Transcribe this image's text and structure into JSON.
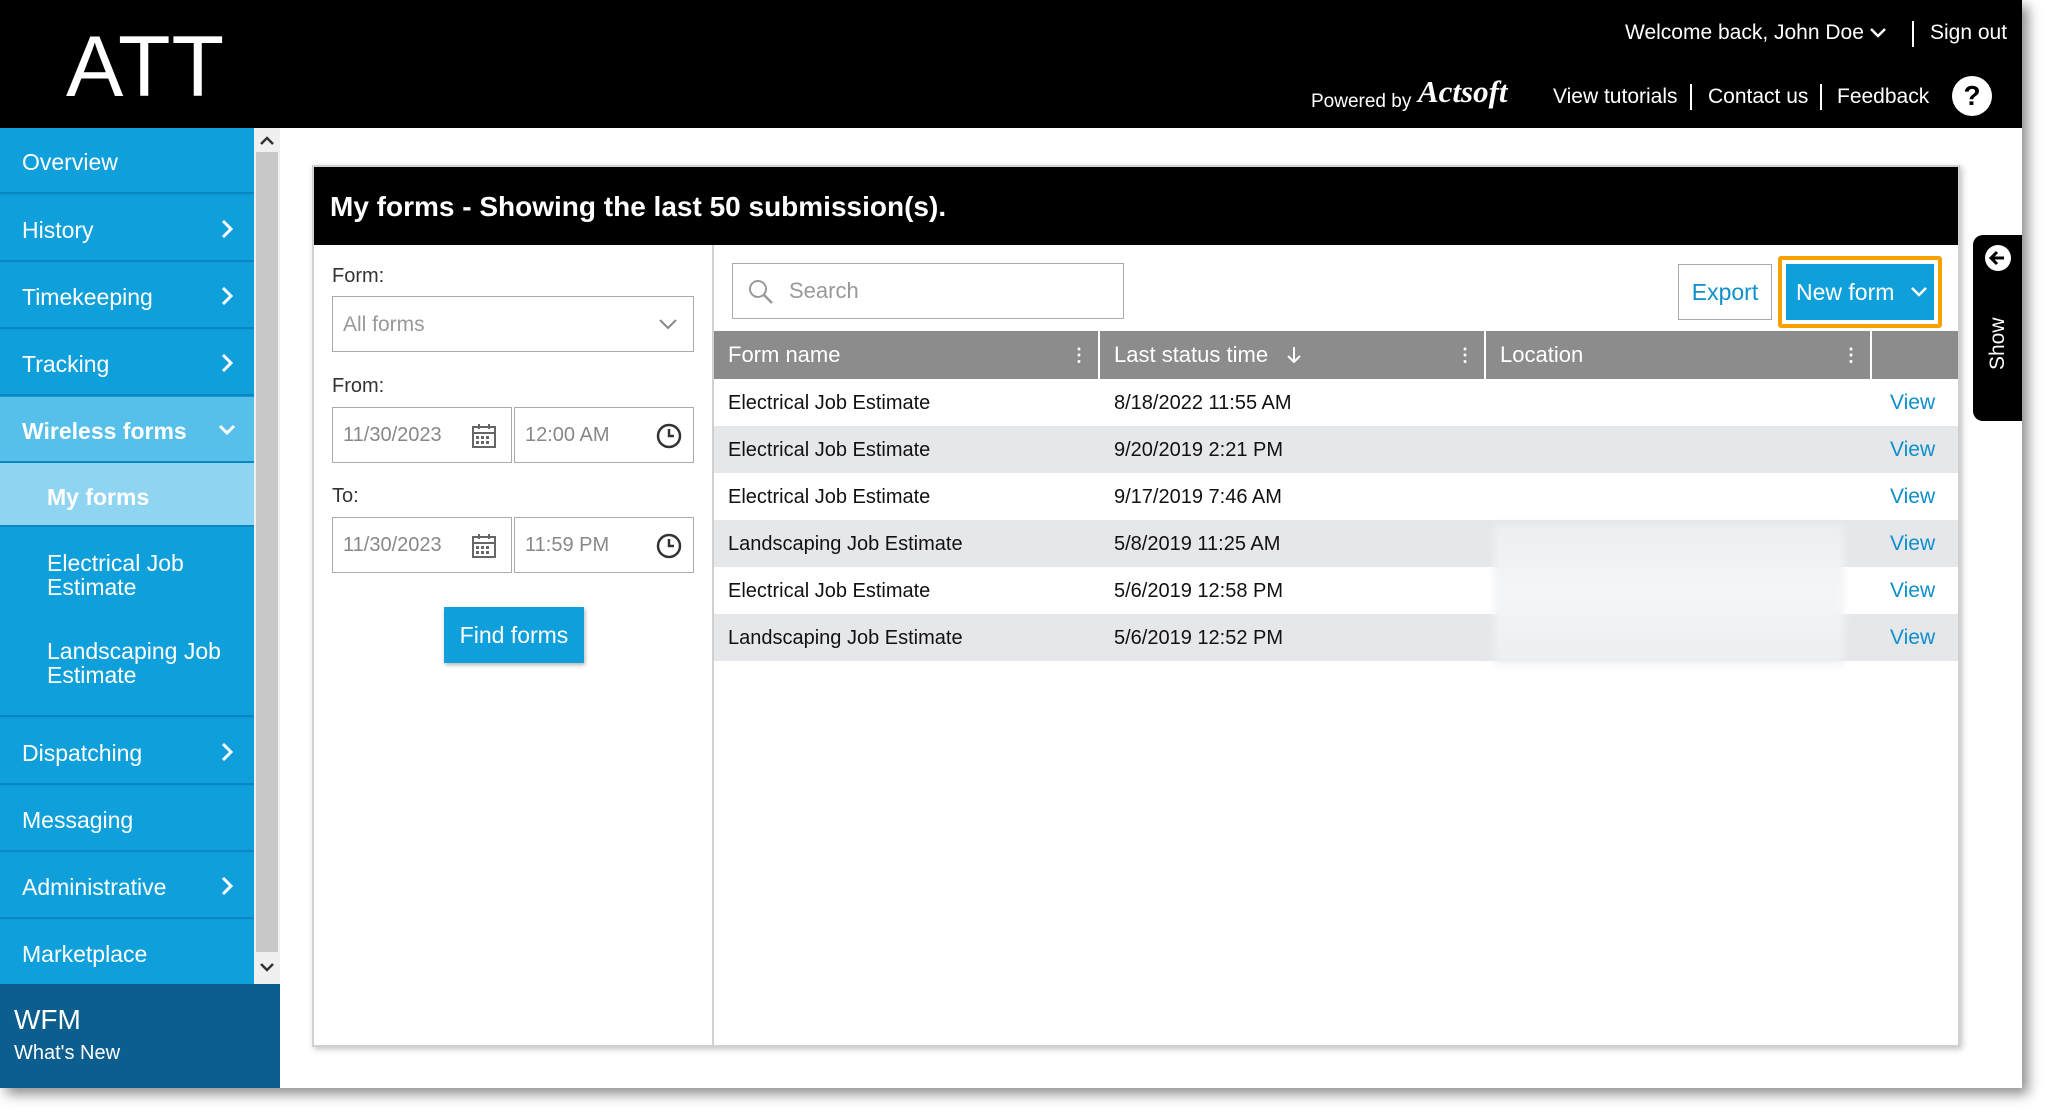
{
  "header": {
    "brand": "ATT",
    "welcome": "Welcome back, John Doe",
    "sign_out": "Sign out",
    "powered_by": "Powered by",
    "powered_logo": "Actsoft",
    "links": [
      "View tutorials",
      "Contact us",
      "Feedback"
    ],
    "help": "?"
  },
  "sidebar": {
    "items": [
      {
        "label": "Overview"
      },
      {
        "label": "History"
      },
      {
        "label": "Timekeeping"
      },
      {
        "label": "Tracking"
      },
      {
        "label": "Wireless forms"
      },
      {
        "label": "My forms"
      },
      {
        "label": "Electrical Job Estimate"
      },
      {
        "label": "Landscaping Job Estimate"
      },
      {
        "label": "Dispatching"
      },
      {
        "label": "Messaging"
      },
      {
        "label": "Administrative"
      },
      {
        "label": "Marketplace"
      }
    ],
    "footer_title": "WFM",
    "footer_sub": "What's New"
  },
  "panel": {
    "title": "My forms - Showing the last 50 submission(s).",
    "filters": {
      "form_label": "Form:",
      "form_value": "All forms",
      "from_label": "From:",
      "from_date": "11/30/2023",
      "from_time": "12:00 AM",
      "to_label": "To:",
      "to_date": "11/30/2023",
      "to_time": "11:59 PM",
      "find": "Find forms"
    },
    "search_placeholder": "Search",
    "export": "Export",
    "new_form": "New form",
    "columns": [
      "Form name",
      "Last status time",
      "Location"
    ],
    "rows": [
      {
        "form": "Electrical Job Estimate",
        "time": "8/18/2022 11:55 AM",
        "action": "View"
      },
      {
        "form": "Electrical Job Estimate",
        "time": "9/20/2019 2:21 PM",
        "action": "View"
      },
      {
        "form": "Electrical Job Estimate",
        "time": "9/17/2019 7:46 AM",
        "action": "View"
      },
      {
        "form": "Landscaping Job Estimate",
        "time": "5/8/2019 11:25 AM",
        "action": "View"
      },
      {
        "form": "Electrical Job Estimate",
        "time": "5/6/2019 12:58 PM",
        "action": "View"
      },
      {
        "form": "Landscaping Job Estimate",
        "time": "5/6/2019 12:52 PM",
        "action": "View"
      }
    ]
  },
  "side_tab": {
    "label": "Show"
  },
  "colors": {
    "accent": "#0fa0dc",
    "highlight": "#f6a300",
    "header": "#000000"
  }
}
